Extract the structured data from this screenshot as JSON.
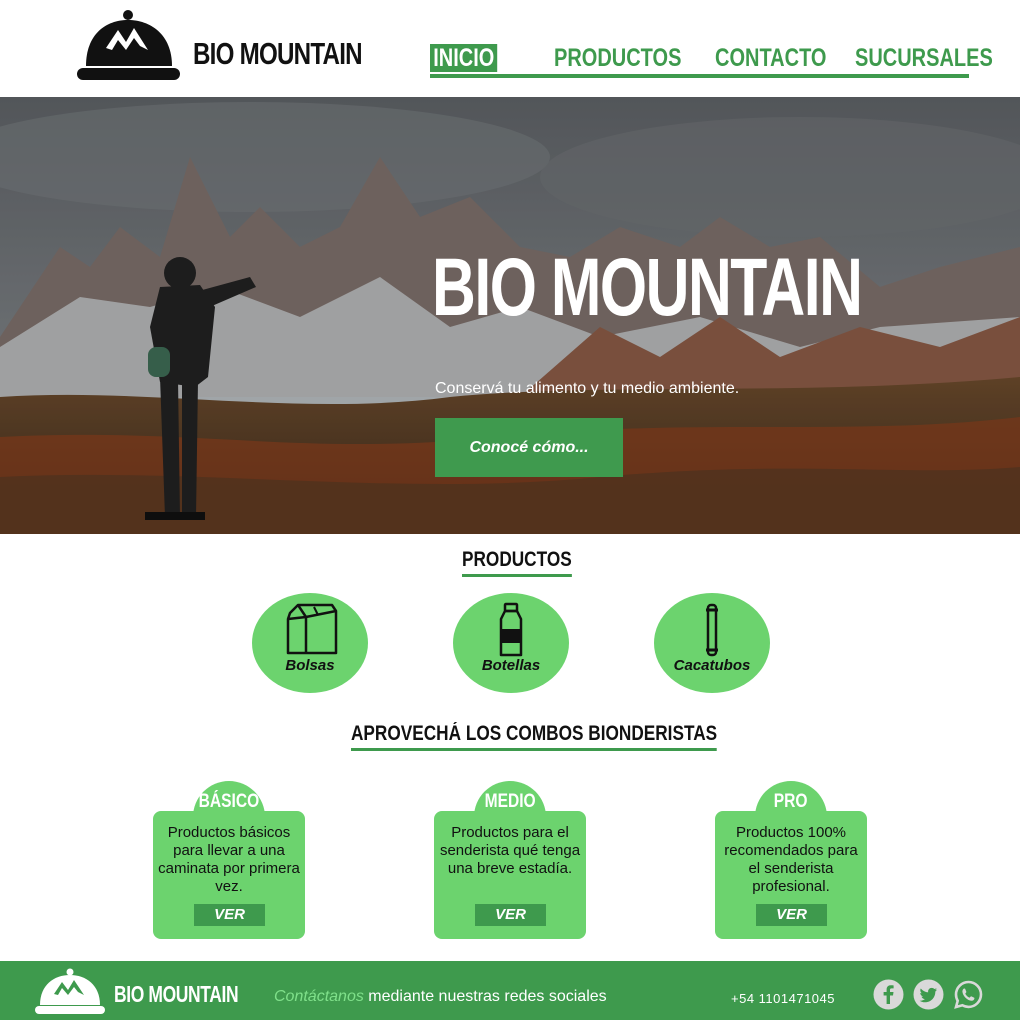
{
  "header": {
    "brand": "BIO MOUNTAIN",
    "nav": [
      {
        "label": "INICIO",
        "active": true
      },
      {
        "label": "PRODUCTOS"
      },
      {
        "label": "CONTACTO"
      },
      {
        "label": "SUCURSALES"
      }
    ]
  },
  "hero": {
    "title": "BIO MOUNTAIN",
    "subtitle": "Conservá tu alimento y tu medio ambiente.",
    "button": "Conocé cómo..."
  },
  "products": {
    "title": "PRODUCTOS",
    "items": [
      {
        "label": "Bolsas",
        "icon": "bag-icon"
      },
      {
        "label": "Botellas",
        "icon": "bottle-icon"
      },
      {
        "label": "Cacatubos",
        "icon": "tube-icon"
      }
    ]
  },
  "combos": {
    "title": "APROVECHÁ LOS COMBOS BIONDERISTAS",
    "items": [
      {
        "name": "BÁSICO",
        "description": "Productos  básicos para llevar a una caminata por primera vez.",
        "button": "VER"
      },
      {
        "name": "MEDIO",
        "description": "Productos para el senderista qué tenga una breve estadía.",
        "button": "VER"
      },
      {
        "name": "PRO",
        "description": "Productos 100% recomendados para el senderista profesional.",
        "button": "VER"
      }
    ]
  },
  "footer": {
    "brand": "BIO MOUNTAIN",
    "contact_highlight": "Contáctanos",
    "contact_rest": " mediante nuestras redes sociales",
    "phone": "+54 1101471045",
    "social": [
      "facebook-icon",
      "twitter-icon",
      "whatsapp-icon"
    ]
  },
  "colors": {
    "brand_green": "#3e9a4d",
    "light_green": "#6cd36e",
    "highlight_green": "#7fe08a"
  }
}
